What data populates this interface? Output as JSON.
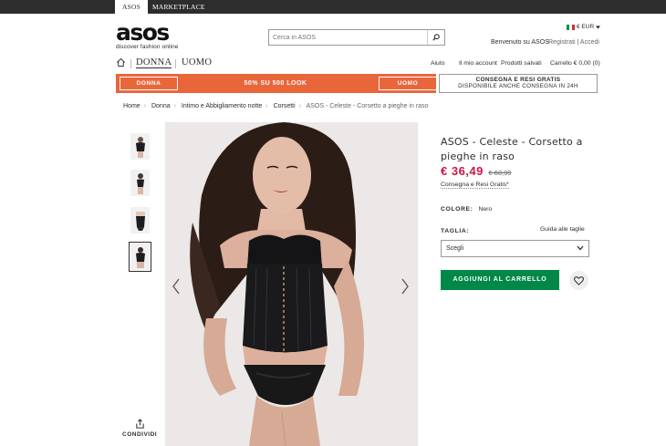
{
  "topbar": {
    "tabs": [
      {
        "label": "ASOS"
      },
      {
        "label": "MARKETPLACE"
      }
    ]
  },
  "header": {
    "logo": {
      "word": "asos",
      "tagline": "discover fashion online"
    },
    "search": {
      "placeholder": "Cerca in ASOS",
      "value": "",
      "icon": "search-icon"
    },
    "locale": {
      "currency": "€ EUR",
      "flag": "italy-flag-icon",
      "chevron": "caret-down-icon"
    },
    "account": {
      "welcome": "Benvenuto su ASOS",
      "register": "Registrati",
      "separator": "|",
      "login": "Accedi"
    }
  },
  "nav": {
    "home_icon": "home-icon",
    "items": [
      {
        "label": "DONNA"
      },
      {
        "label": "UOMO"
      }
    ],
    "right": [
      {
        "label": "Aiuto"
      },
      {
        "label": "Il mio account"
      },
      {
        "label": "Prodotti salvati"
      },
      {
        "label": "Carrello € 0,00 (0)"
      }
    ]
  },
  "promo": {
    "donna_label": "DONNA",
    "text": "50% SU 500 LOOK",
    "uomo_label": "UOMO",
    "delivery_line1": "CONSEGNA E RESI GRATIS",
    "delivery_line2": "DISPONIBILE ANCHE CONSEGNA IN 24H"
  },
  "breadcrumb": [
    {
      "label": "Home"
    },
    {
      "label": "Donna"
    },
    {
      "label": "Intimo e Abbigliamento notte"
    },
    {
      "label": "Corsetti"
    },
    {
      "label": "ASOS - Celeste - Corsetto a pieghe in raso"
    }
  ],
  "gallery": {
    "thumbnails": [
      {
        "selected": false
      },
      {
        "selected": false
      },
      {
        "selected": false
      },
      {
        "selected": true
      }
    ],
    "share_label": "CONDIVIDI",
    "share_icon": "share-icon",
    "prev_icon": "chevron-left-icon",
    "next_icon": "chevron-right-icon"
  },
  "product": {
    "title": "ASOS - Celeste - Corsetto a pieghe in raso",
    "price_now": "€ 36,49",
    "price_was": "€ 60,99",
    "delivery_link": "Consegna e Resi Gratis*",
    "color_label": "COLORE:",
    "color_value": "Nero",
    "size_label": "TAGLIA:",
    "size_guide": "Guida alle taglie",
    "size_select": "Scegli",
    "add_to_cart": "AGGIUNGI AL CARRELLO",
    "wishlist_icon": "heart-icon"
  },
  "colors": {
    "promo": "#e9663b",
    "add_button": "#018849",
    "price": "#d01345",
    "topbar": "#2d2d2d"
  }
}
